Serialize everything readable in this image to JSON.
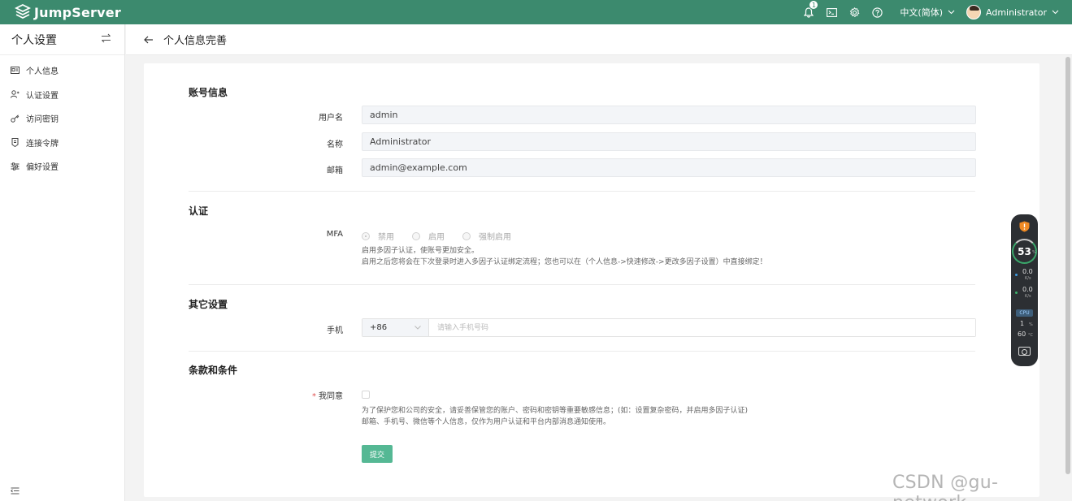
{
  "app": {
    "name": "JumpServer",
    "accent": "#3c8a6e",
    "button_color": "#55b894"
  },
  "topbar": {
    "notification_count": "1",
    "icons": [
      "bell-icon",
      "terminal-icon",
      "gear-icon",
      "help-icon"
    ],
    "language": "中文(简体)",
    "username": "Administrator"
  },
  "sidebar": {
    "title": "个人设置",
    "items": [
      {
        "label": "个人信息",
        "icon": "id-card-icon"
      },
      {
        "label": "认证设置",
        "icon": "user-shield-icon"
      },
      {
        "label": "访问密钥",
        "icon": "key-icon"
      },
      {
        "label": "连接令牌",
        "icon": "token-icon"
      },
      {
        "label": "偏好设置",
        "icon": "sliders-icon"
      }
    ]
  },
  "header": {
    "title": "个人信息完善"
  },
  "form": {
    "account_section": "账号信息",
    "username_label": "用户名",
    "username_value": "admin",
    "name_label": "名称",
    "name_value": "Administrator",
    "email_label": "邮箱",
    "email_value": "admin@example.com",
    "auth_section": "认证",
    "mfa_label": "MFA",
    "mfa_options": [
      "禁用",
      "启用",
      "强制启用"
    ],
    "mfa_selected": "禁用",
    "mfa_help_1": "启用多因子认证，使账号更加安全。",
    "mfa_help_2": "启用之后您将会在下次登录时进入多因子认证绑定流程；您也可以在（个人信息->快速修改->更改多因子设置）中直接绑定！",
    "other_section": "其它设置",
    "phone_label": "手机",
    "phone_prefix": "+86",
    "phone_placeholder": "请输入手机号码",
    "terms_section": "条款和条件",
    "agree_label": "我同意",
    "agree_checked": false,
    "terms_help_1": "为了保护您和公司的安全，请妥善保管您的账户、密码和密钥等重要敏感信息；(如：设置复杂密码，并启用多因子认证)",
    "terms_help_2": "邮箱、手机号、微信等个人信息，仅作为用户认证和平台内部消息通知使用。",
    "submit_label": "提交"
  },
  "monitor": {
    "score": "53",
    "score_unit": "%",
    "upload": "0.0",
    "download": "0.0",
    "rate_unit": "K/s",
    "cpu_label": "CPU",
    "cpu_value": "1",
    "cpu_unit": "%",
    "temp_value": "60",
    "temp_unit": "°C"
  },
  "watermark": "CSDN @gu-network"
}
